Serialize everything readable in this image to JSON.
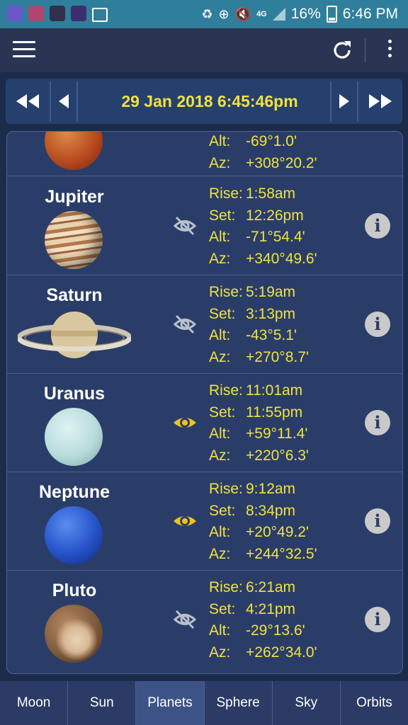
{
  "status_bar": {
    "network": "4G",
    "battery": "16%",
    "time": "6:46 PM"
  },
  "date_nav": {
    "datetime": "29 Jan 2018 6:45:46pm"
  },
  "planets": [
    {
      "name": "",
      "rise": "",
      "set": "",
      "alt": "-69°1.0'",
      "az": "+308°20.2'",
      "visible": false
    },
    {
      "name": "Jupiter",
      "rise": "1:58am",
      "set": "12:26pm",
      "alt": "-71°54.4'",
      "az": "+340°49.6'",
      "visible": false
    },
    {
      "name": "Saturn",
      "rise": "5:19am",
      "set": "3:13pm",
      "alt": "-43°5.1'",
      "az": "+270°8.7'",
      "visible": false
    },
    {
      "name": "Uranus",
      "rise": "11:01am",
      "set": "11:55pm",
      "alt": "+59°11.4'",
      "az": "+220°6.3'",
      "visible": true
    },
    {
      "name": "Neptune",
      "rise": "9:12am",
      "set": "8:34pm",
      "alt": "+20°49.2'",
      "az": "+244°32.5'",
      "visible": true
    },
    {
      "name": "Pluto",
      "rise": "6:21am",
      "set": "4:21pm",
      "alt": "-29°13.6'",
      "az": "+262°34.0'",
      "visible": false
    }
  ],
  "field_labels": {
    "rise": "Rise:",
    "set": "Set:",
    "alt": "Alt:",
    "az": "Az:"
  },
  "info_glyph": "i",
  "tabs": [
    "Moon",
    "Sun",
    "Planets",
    "Sphere",
    "Sky",
    "Orbits"
  ],
  "active_tab": "Planets",
  "colors": {
    "accent_yellow": "#f1e23e",
    "panel": "#2a3d69",
    "status_bar": "#2f7f9c"
  }
}
